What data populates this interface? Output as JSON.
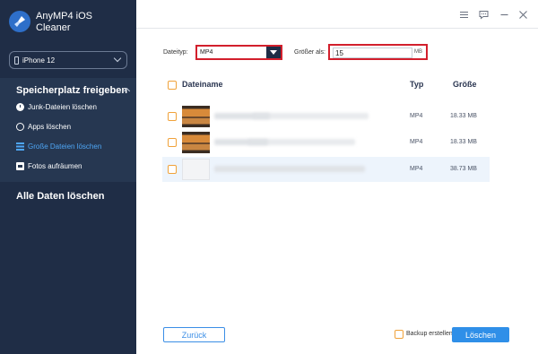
{
  "app": {
    "title": "AnyMP4 iOS Cleaner"
  },
  "device": {
    "name": "iPhone 12"
  },
  "sidebar": {
    "section_title": "Speicherplatz freigeben",
    "items": [
      {
        "label": "Junk-Dateien löschen",
        "icon": "clock-icon",
        "active": false
      },
      {
        "label": "Apps löschen",
        "icon": "apps-icon",
        "active": false
      },
      {
        "label": "Große Dateien löschen",
        "icon": "files-icon",
        "active": true
      },
      {
        "label": "Fotos aufräumen",
        "icon": "photo-icon",
        "active": false
      }
    ],
    "erase_all": "Alle Daten löschen"
  },
  "filters": {
    "type_label": "Dateityp:",
    "type_value": "MP4",
    "size_label": "Größer als:",
    "size_value": "15",
    "size_unit": "MB"
  },
  "table": {
    "headers": {
      "name": "Dateiname",
      "type": "Typ",
      "size": "Größe"
    },
    "rows": [
      {
        "type": "MP4",
        "size": "18.33 MB",
        "thumb": "video"
      },
      {
        "type": "MP4",
        "size": "18.33 MB",
        "thumb": "video"
      },
      {
        "type": "MP4",
        "size": "38.73 MB",
        "thumb": "blank"
      }
    ]
  },
  "footer": {
    "back": "Zurück",
    "backup": "Backup erstellen",
    "delete": "Löschen"
  },
  "colors": {
    "sidebar_bg": "#1f2d46",
    "accent": "#2f8fe8",
    "highlight_border": "#d21f2c",
    "checkbox": "#f0a23a"
  }
}
